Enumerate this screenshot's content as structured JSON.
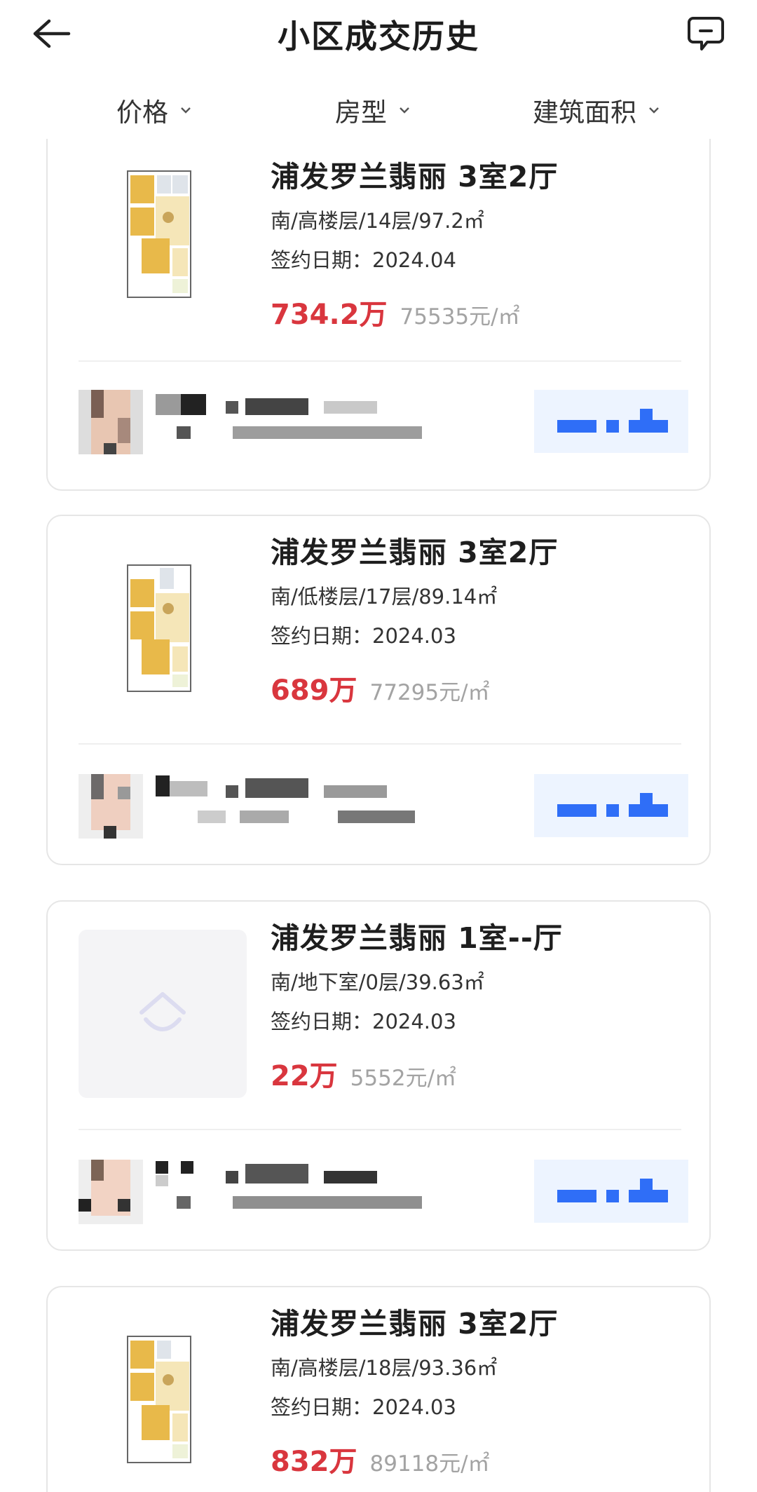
{
  "header": {
    "title": "小区成交历史",
    "back_icon": "arrow-left-icon",
    "message_icon": "chat-bubble-icon"
  },
  "filters": [
    {
      "label": "价格"
    },
    {
      "label": "房型"
    },
    {
      "label": "建筑面积"
    }
  ],
  "listings": [
    {
      "name": "浦发罗兰翡丽 3室2厅",
      "meta": "南/高楼层/14层/97.2㎡",
      "date": "签约日期：2024.04",
      "price": "734.2万",
      "unit_price": "75535元/㎡",
      "image": "floorplan"
    },
    {
      "name": "浦发罗兰翡丽 3室2厅",
      "meta": "南/低楼层/17层/89.14㎡",
      "date": "签约日期：2024.03",
      "price": "689万",
      "unit_price": "77295元/㎡",
      "image": "floorplan"
    },
    {
      "name": "浦发罗兰翡丽 1室--厅",
      "meta": "南/地下室/0层/39.63㎡",
      "date": "签约日期：2024.03",
      "price": "22万",
      "unit_price": "5552元/㎡",
      "image": "placeholder"
    },
    {
      "name": "浦发罗兰翡丽 3室2厅",
      "meta": "南/高楼层/18层/93.36㎡",
      "date": "签约日期：2024.03",
      "price": "832万",
      "unit_price": "89118元/㎡",
      "image": "floorplan"
    }
  ],
  "colors": {
    "price": "#d9363e",
    "accent_blue": "#2f6ef7",
    "border": "#e6e6e6"
  }
}
